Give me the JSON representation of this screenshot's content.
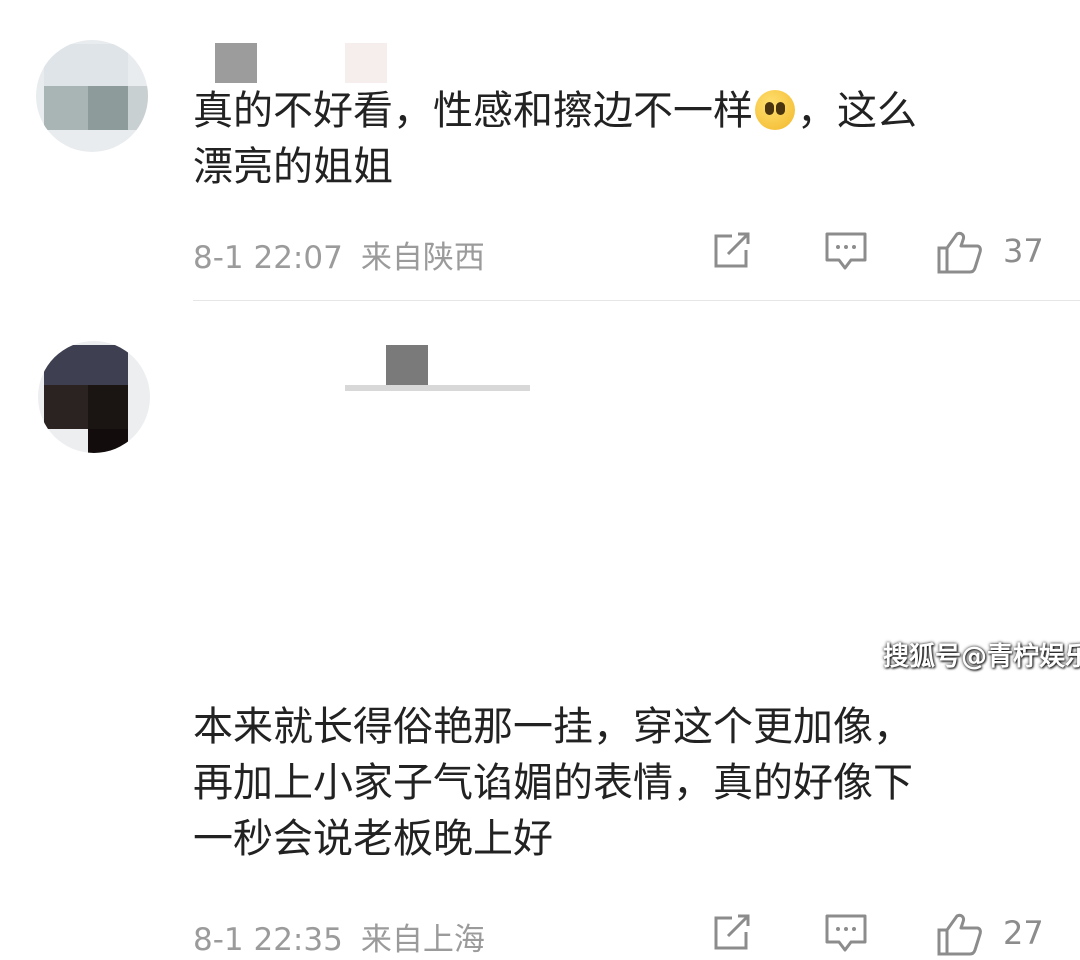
{
  "comments": [
    {
      "text_line1": "真的不好看，性感和擦边不一样",
      "text_line1_tail": "，这么",
      "text_line2": "漂亮的姐姐",
      "emoji": "crying-face-emoji",
      "time": "8-1 22:07",
      "location": "来自陕西",
      "likes": "37"
    },
    {
      "text_line1": "本来就长得俗艳那一挂，穿这个更加像，",
      "text_line2": "再加上小家子气谄媚的表情，真的好像下",
      "text_line3": "一秒会说老板晚上好",
      "time": "8-1 22:35",
      "location": "来自上海",
      "likes": "27"
    }
  ],
  "icons": {
    "share": "share-edit-icon",
    "reply": "comment-bubble-icon",
    "like": "thumbs-up-icon"
  },
  "watermark": "搜狐号@青柠娱乐",
  "colors": {
    "text": "#222222",
    "meta": "#9b9b9b",
    "icon": "#8c8c8c",
    "divider": "#e6e6e6"
  }
}
